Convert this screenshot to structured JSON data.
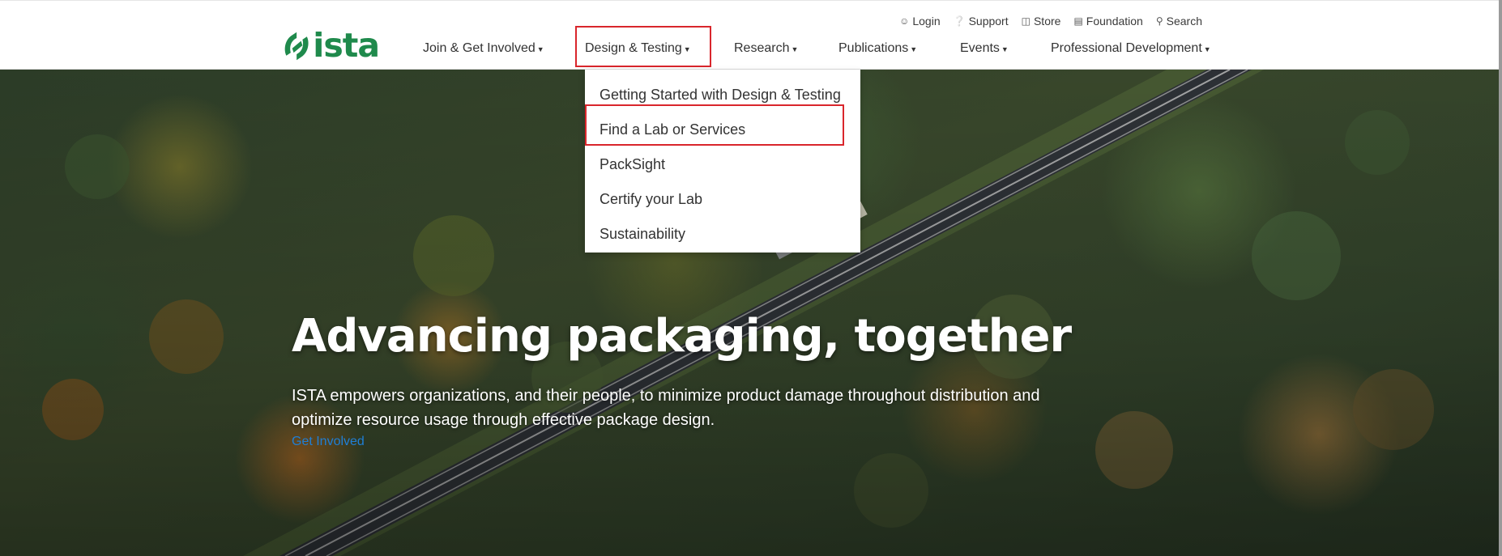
{
  "header": {
    "logo_text": "ista",
    "logo_color": "#1f8a4c",
    "utility_nav": [
      {
        "label": "Login",
        "icon": "user-circle-icon"
      },
      {
        "label": "Support",
        "icon": "question-circle-icon"
      },
      {
        "label": "Store",
        "icon": "basket-icon"
      },
      {
        "label": "Foundation",
        "icon": "book-icon"
      },
      {
        "label": "Search",
        "icon": "search-icon"
      }
    ],
    "main_nav": [
      {
        "label": "Join & Get Involved"
      },
      {
        "label": "Design & Testing",
        "active": true
      },
      {
        "label": "Research"
      },
      {
        "label": "Publications"
      },
      {
        "label": "Events"
      },
      {
        "label": "Professional Development"
      }
    ],
    "highlight_color": "#d9262c"
  },
  "dropdown": {
    "items": [
      "Getting Started with Design & Testing",
      "Find a Lab or Services",
      "PackSight",
      "Certify your Lab",
      "Sustainability"
    ],
    "highlighted_item": "Find a Lab or Services"
  },
  "hero": {
    "title": "Advancing packaging, together",
    "text": "ISTA empowers organizations, and their people, to minimize product damage throughout distribution and optimize resource usage through effective package design.",
    "link_label": "Get Involved",
    "link_color": "#1f7fd6"
  }
}
